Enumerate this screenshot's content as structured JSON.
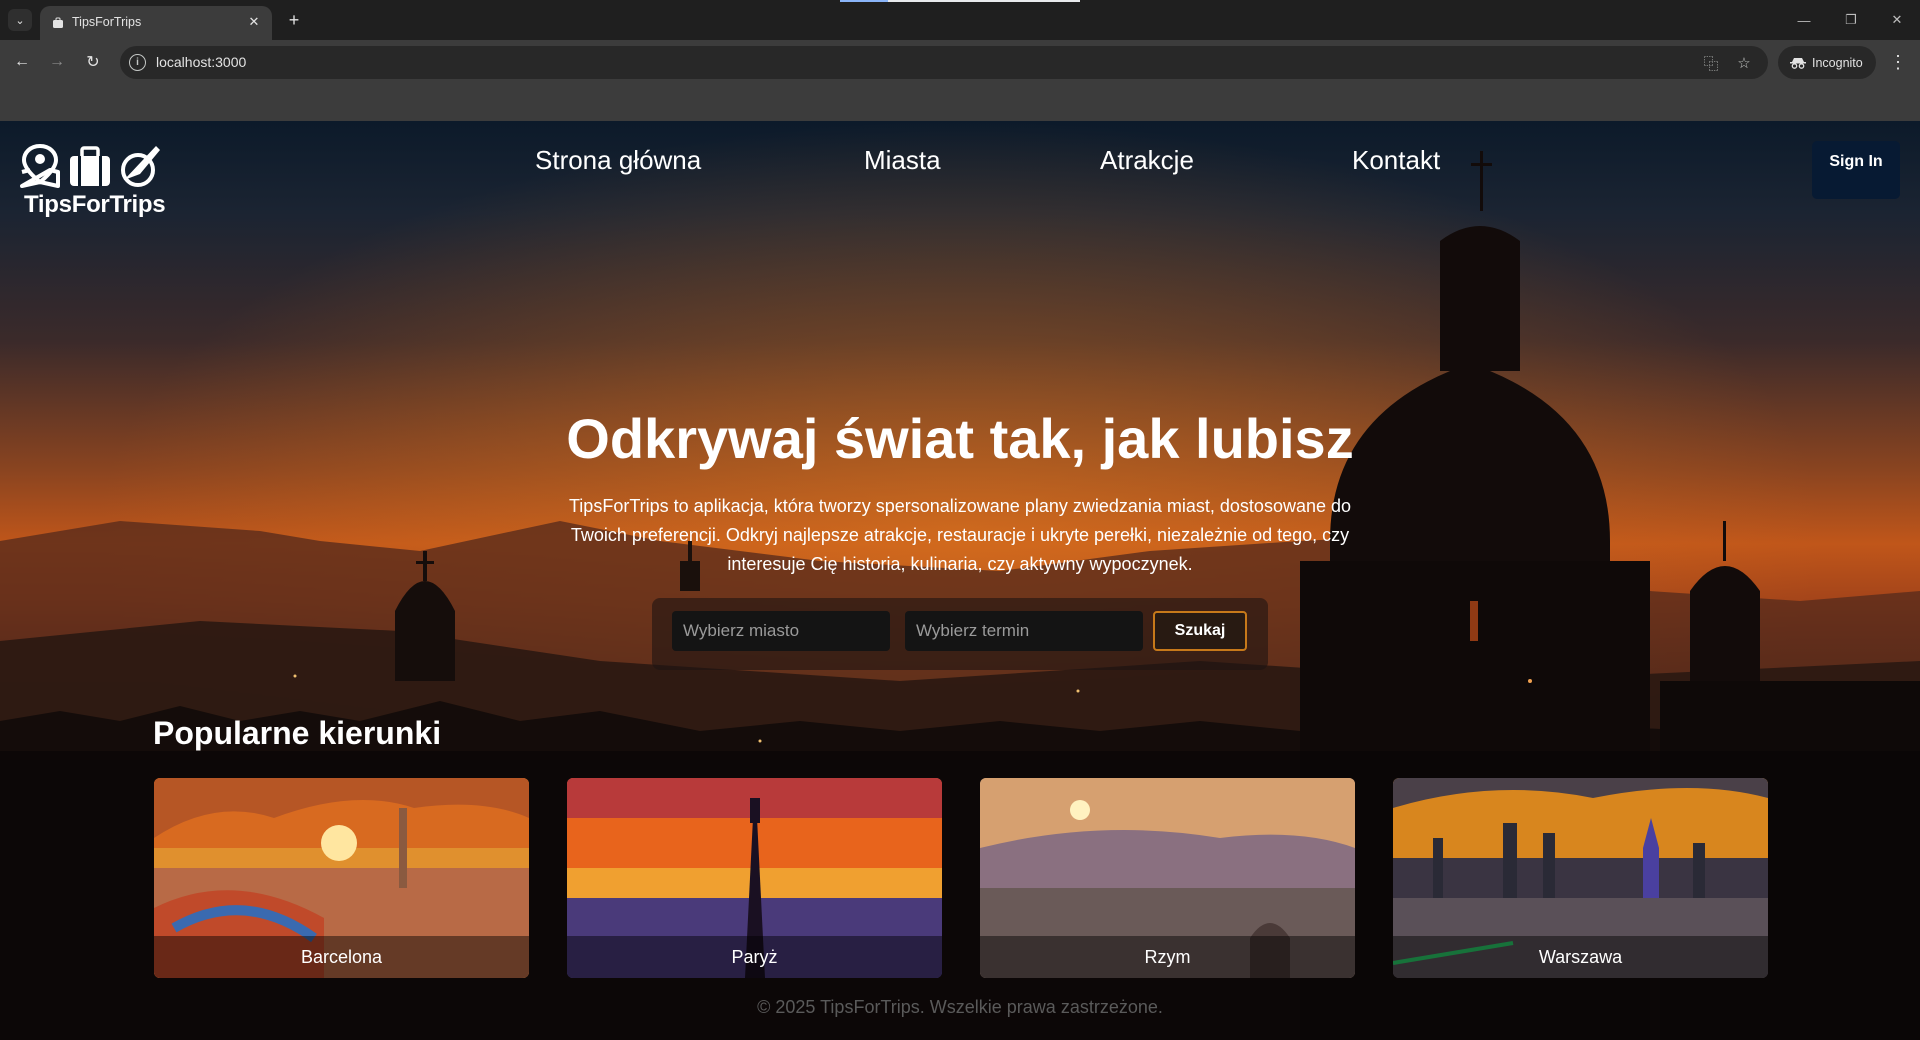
{
  "browser": {
    "tab_title": "TipsForTrips",
    "url": "localhost:3000",
    "profile_label": "Incognito"
  },
  "site": {
    "logo_text": "TipsForTrips",
    "nav": [
      {
        "label": "Strona główna"
      },
      {
        "label": "Miasta"
      },
      {
        "label": "Atrakcje"
      },
      {
        "label": "Kontakt"
      }
    ],
    "signin_label": "Sign In"
  },
  "hero": {
    "title": "Odkrywaj świat tak, jak lubisz",
    "description": "TipsForTrips to aplikacja, która tworzy spersonalizowane plany zwiedzania miast, dostosowane do Twoich preferencji. Odkryj najlepsze atrakcje, restauracje i ukryte perełki, niezależnie od tego, czy interesuje Cię historia, kulinaria, czy aktywny wypoczynek."
  },
  "search": {
    "city_placeholder": "Wybierz miasto",
    "date_placeholder": "Wybierz termin",
    "button_label": "Szukaj"
  },
  "popular": {
    "title": "Popularne kierunki",
    "cards": [
      {
        "label": "Barcelona"
      },
      {
        "label": "Paryż"
      },
      {
        "label": "Rzym"
      },
      {
        "label": "Warszawa"
      }
    ]
  },
  "footer": {
    "text": "© 2025 TipsForTrips. Wszelkie prawa zastrzeżone."
  },
  "colors": {
    "accent_orange": "#c7791a",
    "signin_bg": "#071a33",
    "chrome_bg": "#3c3c3c"
  }
}
